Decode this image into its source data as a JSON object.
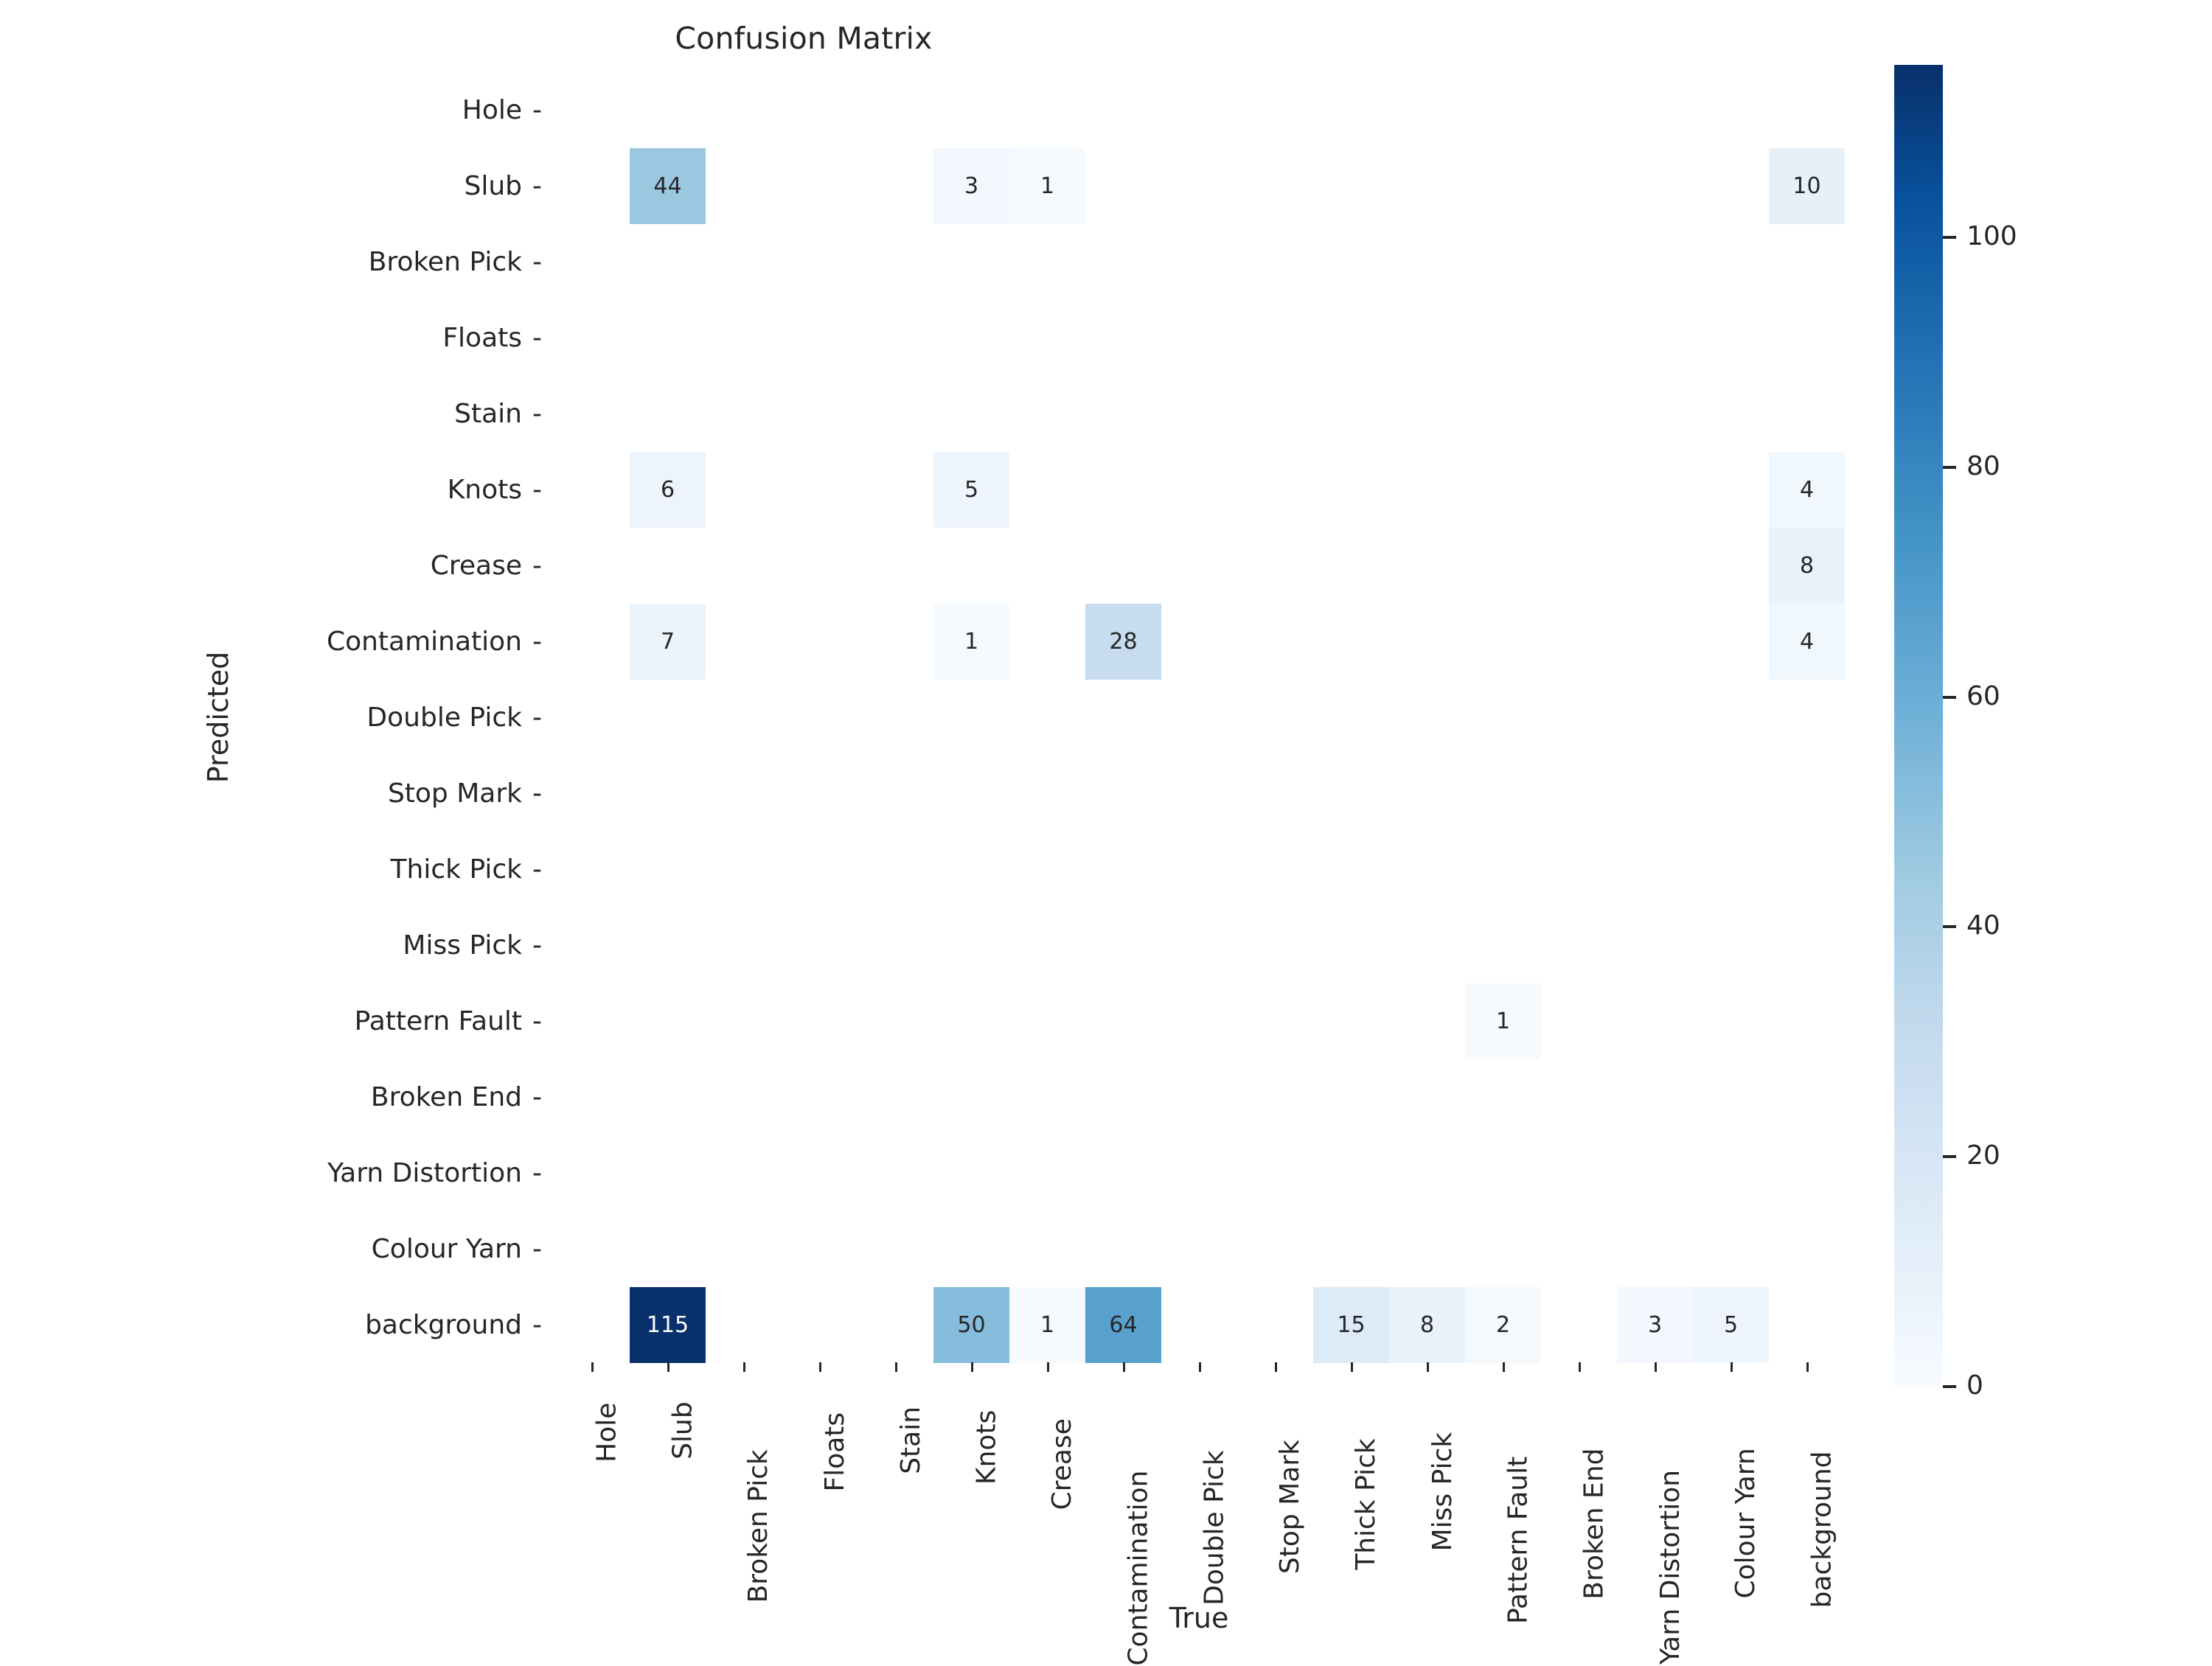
{
  "title": "Confusion Matrix",
  "axes": {
    "xlabel": "True",
    "ylabel": "Predicted",
    "tick_dash": "-"
  },
  "colorbar": {
    "ticks": [
      "0",
      "20",
      "40",
      "60",
      "80",
      "100"
    ],
    "tick_values": [
      0,
      20,
      40,
      60,
      80,
      100
    ],
    "vmin": 0,
    "vmax": 115,
    "colormap": "Blues",
    "low_color": "#f7fbff",
    "high_color": "#08306b"
  },
  "chart_data": {
    "type": "heatmap",
    "title": "Confusion Matrix",
    "xlabel": "True",
    "ylabel": "Predicted",
    "grid": false,
    "legend": "colorbar-right",
    "colormap": "Blues",
    "vmin": 0,
    "vmax": 115,
    "annotate": true,
    "hide_zeros": true,
    "x_categories": [
      "Hole",
      "Slub",
      "Broken Pick",
      "Floats",
      "Stain",
      "Knots",
      "Crease",
      "Contamination",
      "Double Pick",
      "Stop Mark",
      "Thick Pick",
      "Miss Pick",
      "Pattern Fault",
      "Broken End",
      "Yarn Distortion",
      "Colour Yarn",
      "background"
    ],
    "y_categories": [
      "Hole",
      "Slub",
      "Broken Pick",
      "Floats",
      "Stain",
      "Knots",
      "Crease",
      "Contamination",
      "Double Pick",
      "Stop Mark",
      "Thick Pick",
      "Miss Pick",
      "Pattern Fault",
      "Broken End",
      "Yarn Distortion",
      "Colour Yarn",
      "background"
    ],
    "values": [
      [
        0,
        0,
        0,
        0,
        0,
        0,
        0,
        0,
        0,
        0,
        0,
        0,
        0,
        0,
        0,
        0,
        0
      ],
      [
        0,
        44,
        0,
        0,
        0,
        3,
        1,
        0,
        0,
        0,
        0,
        0,
        0,
        0,
        0,
        0,
        10
      ],
      [
        0,
        0,
        0,
        0,
        0,
        0,
        0,
        0,
        0,
        0,
        0,
        0,
        0,
        0,
        0,
        0,
        0
      ],
      [
        0,
        0,
        0,
        0,
        0,
        0,
        0,
        0,
        0,
        0,
        0,
        0,
        0,
        0,
        0,
        0,
        0
      ],
      [
        0,
        0,
        0,
        0,
        0,
        0,
        0,
        0,
        0,
        0,
        0,
        0,
        0,
        0,
        0,
        0,
        0
      ],
      [
        0,
        6,
        0,
        0,
        0,
        5,
        0,
        0,
        0,
        0,
        0,
        0,
        0,
        0,
        0,
        0,
        4
      ],
      [
        0,
        0,
        0,
        0,
        0,
        0,
        0,
        0,
        0,
        0,
        0,
        0,
        0,
        0,
        0,
        0,
        8
      ],
      [
        0,
        7,
        0,
        0,
        0,
        1,
        0,
        28,
        0,
        0,
        0,
        0,
        0,
        0,
        0,
        0,
        4
      ],
      [
        0,
        0,
        0,
        0,
        0,
        0,
        0,
        0,
        0,
        0,
        0,
        0,
        0,
        0,
        0,
        0,
        0
      ],
      [
        0,
        0,
        0,
        0,
        0,
        0,
        0,
        0,
        0,
        0,
        0,
        0,
        0,
        0,
        0,
        0,
        0
      ],
      [
        0,
        0,
        0,
        0,
        0,
        0,
        0,
        0,
        0,
        0,
        0,
        0,
        0,
        0,
        0,
        0,
        0
      ],
      [
        0,
        0,
        0,
        0,
        0,
        0,
        0,
        0,
        0,
        0,
        0,
        0,
        0,
        0,
        0,
        0,
        0
      ],
      [
        0,
        0,
        0,
        0,
        0,
        0,
        0,
        0,
        0,
        0,
        0,
        0,
        1,
        0,
        0,
        0,
        0
      ],
      [
        0,
        0,
        0,
        0,
        0,
        0,
        0,
        0,
        0,
        0,
        0,
        0,
        0,
        0,
        0,
        0,
        0
      ],
      [
        0,
        0,
        0,
        0,
        0,
        0,
        0,
        0,
        0,
        0,
        0,
        0,
        0,
        0,
        0,
        0,
        0
      ],
      [
        0,
        0,
        0,
        0,
        0,
        0,
        0,
        0,
        0,
        0,
        0,
        0,
        0,
        0,
        0,
        0,
        0
      ],
      [
        0,
        115,
        0,
        0,
        0,
        50,
        1,
        64,
        0,
        0,
        15,
        8,
        2,
        0,
        3,
        5,
        0
      ]
    ]
  }
}
